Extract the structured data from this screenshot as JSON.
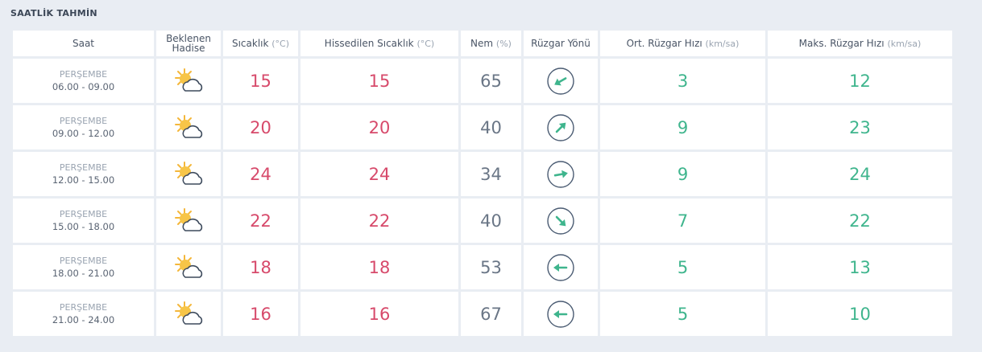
{
  "title": "SAATLİK TAHMİN",
  "headers": {
    "saat": "Saat",
    "hadise_1": "Beklenen",
    "hadise_2": "Hadise",
    "sicaklik": "Sıcaklık",
    "sicaklik_unit": "(°C)",
    "hissedilen": "Hissedilen Sıcaklık",
    "hissedilen_unit": "(°C)",
    "nem": "Nem",
    "nem_unit": "(%)",
    "yon": "Rüzgar Yönü",
    "ort": "Ort. Rüzgar Hızı",
    "ort_unit": "(km/sa)",
    "maks": "Maks. Rüzgar Hızı",
    "maks_unit": "(km/sa)"
  },
  "weather_icon": "partly-cloudy-icon",
  "colors": {
    "temperature": "#d74a6b",
    "wind": "#3fb58d",
    "humidity": "#6a7686"
  },
  "rows": [
    {
      "day": "PERŞEMBE",
      "time": "06.00 - 09.00",
      "temp": "15",
      "feels": "15",
      "nem": "65",
      "dir_deg": 240,
      "ort": "3",
      "maks": "12"
    },
    {
      "day": "PERŞEMBE",
      "time": "09.00 - 12.00",
      "temp": "20",
      "feels": "20",
      "nem": "40",
      "dir_deg": 45,
      "ort": "9",
      "maks": "23"
    },
    {
      "day": "PERŞEMBE",
      "time": "12.00 - 15.00",
      "temp": "24",
      "feels": "24",
      "nem": "34",
      "dir_deg": 80,
      "ort": "9",
      "maks": "24"
    },
    {
      "day": "PERŞEMBE",
      "time": "15.00 - 18.00",
      "temp": "22",
      "feels": "22",
      "nem": "40",
      "dir_deg": 135,
      "ort": "7",
      "maks": "22"
    },
    {
      "day": "PERŞEMBE",
      "time": "18.00 - 21.00",
      "temp": "18",
      "feels": "18",
      "nem": "53",
      "dir_deg": 270,
      "ort": "5",
      "maks": "13"
    },
    {
      "day": "PERŞEMBE",
      "time": "21.00 - 24.00",
      "temp": "16",
      "feels": "16",
      "nem": "67",
      "dir_deg": 270,
      "ort": "5",
      "maks": "10"
    }
  ]
}
